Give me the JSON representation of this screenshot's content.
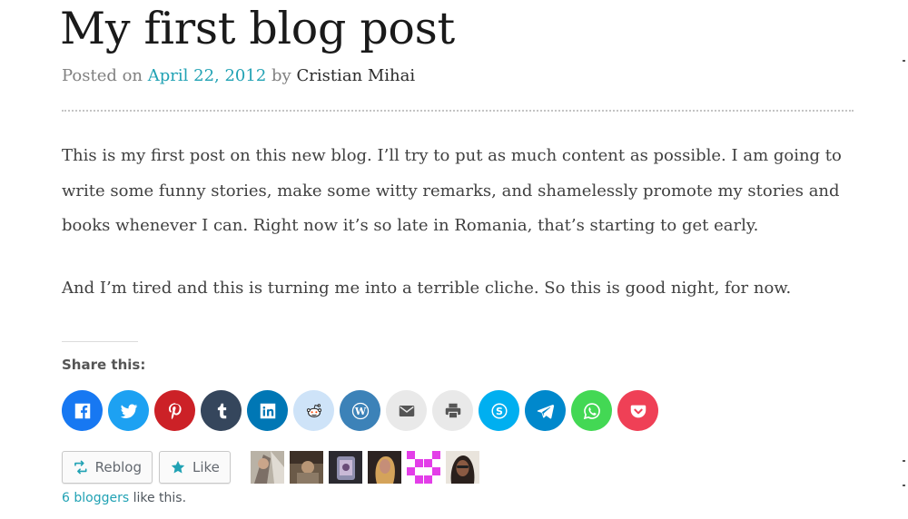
{
  "post": {
    "title": "My first blog post",
    "meta": {
      "posted_on": "Posted on",
      "date": "April 22, 2012",
      "by": "by",
      "author": "Cristian Mihai"
    },
    "paragraphs": [
      [
        "This is my first post on this new blog. I’ll try to put as much content as possible. I am going to",
        "write some funny stories, make some witty remarks, and shamelessly promote my stories and",
        "books whenever I can. Right now it’s so late in Romania, that’s starting to get early."
      ],
      [
        "And I’m tired and this is turning me into a terrible cliche. So this is good night, for now."
      ]
    ]
  },
  "share": {
    "title": "Share this:",
    "buttons": [
      {
        "name": "facebook",
        "color": "#1778f2",
        "icon": "facebook-icon"
      },
      {
        "name": "twitter",
        "color": "#1da1f2",
        "icon": "twitter-icon"
      },
      {
        "name": "pinterest",
        "color": "#cc2127",
        "icon": "pinterest-icon"
      },
      {
        "name": "tumblr",
        "color": "#35465c",
        "icon": "tumblr-icon"
      },
      {
        "name": "linkedin",
        "color": "#0077b5",
        "icon": "linkedin-icon"
      },
      {
        "name": "reddit",
        "color": "#cee3f8",
        "icon": "reddit-icon"
      },
      {
        "name": "wordpress",
        "color": "#3c82b8",
        "icon": "wordpress-icon"
      },
      {
        "name": "email",
        "color": "#e9e9e9",
        "icon": "email-icon"
      },
      {
        "name": "print",
        "color": "#e9e9e9",
        "icon": "print-icon"
      },
      {
        "name": "skype",
        "color": "#00aff0",
        "icon": "skype-icon"
      },
      {
        "name": "telegram",
        "color": "#0088cc",
        "icon": "telegram-icon"
      },
      {
        "name": "whatsapp",
        "color": "#43d854",
        "icon": "whatsapp-icon"
      },
      {
        "name": "pocket",
        "color": "#ef4056",
        "icon": "pocket-icon"
      }
    ]
  },
  "likes": {
    "reblog_label": "Reblog",
    "like_label": "Like",
    "count_link": "6 bloggers",
    "suffix": " like this.",
    "avatars": 6
  },
  "colors": {
    "accent": "#21a2b4",
    "title": "#1a1a1a",
    "body": "#404040"
  }
}
